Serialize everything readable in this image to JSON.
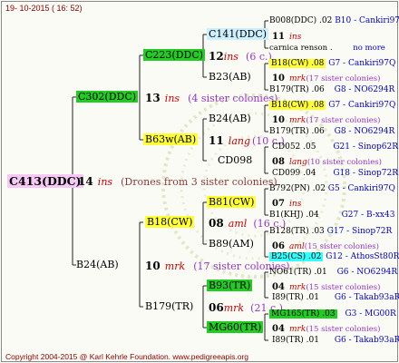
{
  "header": {
    "date": "19- 10-2015 ( 16: 52)"
  },
  "footer": {
    "copyright": "Copyright 2004-2015 @ Karl Kehrle Foundation.   www.pedigreeapis.org"
  },
  "root": {
    "id": "C413(DDC)",
    "year": "14",
    "mark": "ins",
    "note": "(Drones from 3 sister colonies)"
  },
  "gen1": [
    {
      "id": "C302(DDC)",
      "year": "13",
      "mark": "ins",
      "note": "(4 sister colonies)"
    },
    {
      "id": "B24(AB)",
      "year": "10",
      "mark": "mrk",
      "note": "(17 sister colonies)"
    }
  ],
  "gen2": [
    {
      "id": "C223(DDC)",
      "year": "12",
      "mark": "ins",
      "note": "(6 c.)"
    },
    {
      "id": "B63w(AB)",
      "year": "11",
      "mark": "lang",
      "note": "(10 c.)"
    },
    {
      "id": "B18(CW)",
      "year": "08",
      "mark": "aml",
      "note": "(16 c.)"
    },
    {
      "id": "B179(TR)",
      "year": "06",
      "mark": "mrk",
      "note": "(21 c.)"
    }
  ],
  "gen3": [
    {
      "id": "C141(DDC)",
      "year": "11",
      "mark": "ins"
    },
    {
      "id": "B23(AB)"
    },
    {
      "id": "B24(AB)",
      "year": "10",
      "mark": "mrk"
    },
    {
      "id": "CD098"
    },
    {
      "id": "B81(CW)",
      "year": "07",
      "mark": "ins"
    },
    {
      "id": "B89(AM)"
    },
    {
      "id": "B93(TR)",
      "year": "04",
      "mark": "mrk"
    },
    {
      "id": "MG60(TR)"
    }
  ],
  "gen4": {
    "r1": {
      "a": "B008(DDC) .",
      "b": "02",
      "c": "B10 - Cankiri97Q"
    },
    "r2": {
      "a": "11",
      "b": "ins"
    },
    "r3": {
      "a": "carnica renson .",
      "b": "no more"
    },
    "r4": {
      "a": "B18(CW) .08",
      "b": "G7 - Cankiri97Q"
    },
    "r5": {
      "a": "10",
      "b": "mrk",
      "c": "(17 sister colonies)"
    },
    "r6": {
      "a": "B179(TR) .06",
      "b": "G8 - NO6294R"
    },
    "r7": {
      "a": "B18(CW) .08",
      "b": "G7 - Cankiri97Q"
    },
    "r8": {
      "a": "10",
      "b": "mrk",
      "c": "(17 sister colonies)"
    },
    "r9": {
      "a": "B179(TR) .06",
      "b": "G8 - NO6294R"
    },
    "r10": {
      "a": "CD052 .05",
      "b": "G21 - Sinop62R"
    },
    "r11": {
      "a": "08",
      "b": "lang",
      "c": "(10 sister colonies)"
    },
    "r12": {
      "a": "CD099 .04",
      "b": "G18 - Sinop72R"
    },
    "r13": {
      "a": "B792(PN) .02",
      "b": "G5 - Cankiri97Q"
    },
    "r14": {
      "a": "07",
      "b": "ins"
    },
    "r15": {
      "a": "B1(KHJ) .04",
      "b": "G27 - B-xx43"
    },
    "r16": {
      "a": "B128(TR) .03",
      "b": "G17 - Sinop72R"
    },
    "r17": {
      "a": "06",
      "b": "aml",
      "c": "(15 sister colonies)"
    },
    "r18": {
      "a": "B25(CS) .02",
      "b": "G12 - AthosSt80R"
    },
    "r19": {
      "a": "NO61(TR) .01",
      "b": "G6 - NO6294R"
    },
    "r20": {
      "a": "04",
      "b": "mrk",
      "c": "(15 sister colonies)"
    },
    "r21": {
      "a": "I89(TR) .01",
      "b": "G6 - Takab93aR"
    },
    "r22": {
      "a": "MG165(TR) .03",
      "b": "G3 - MG00R"
    },
    "r23": {
      "a": "04",
      "b": "mrk",
      "c": "(15 sister colonies)"
    },
    "r24": {
      "a": "I89(TR) .01",
      "b": "G6 - Takab93aR"
    }
  }
}
